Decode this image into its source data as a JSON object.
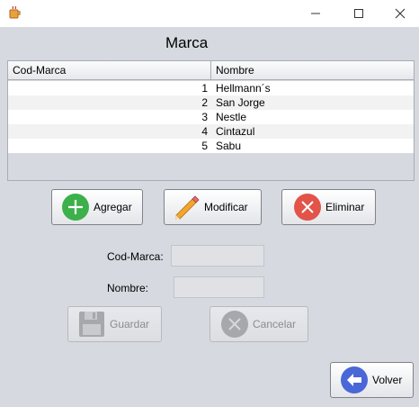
{
  "window": {
    "title": "",
    "icon": "java-cup-icon",
    "controls": [
      "minimize-icon",
      "maximize-icon",
      "close-icon"
    ]
  },
  "form": {
    "title": "Marca"
  },
  "table": {
    "columns": [
      "Cod-Marca",
      "Nombre"
    ],
    "rows": [
      {
        "cod": "1",
        "nombre": "Hellmann´s"
      },
      {
        "cod": "2",
        "nombre": "San Jorge"
      },
      {
        "cod": "3",
        "nombre": "Nestle"
      },
      {
        "cod": "4",
        "nombre": "Cintazul"
      },
      {
        "cod": "5",
        "nombre": "Sabu"
      }
    ]
  },
  "actions": {
    "agregar": {
      "label": "Agregar",
      "icon": "plus-icon",
      "color": "#3cb04a"
    },
    "modificar": {
      "label": "Modificar",
      "icon": "pencil-icon",
      "color": "#f2a72c"
    },
    "eliminar": {
      "label": "Eliminar",
      "icon": "x-circle-icon",
      "color": "#e2534a"
    }
  },
  "fields": {
    "cod_label": "Cod-Marca:",
    "cod_value": "",
    "nombre_label": "Nombre:",
    "nombre_value": ""
  },
  "edit_actions": {
    "guardar": {
      "label": "Guardar",
      "icon": "floppy-disk-icon",
      "enabled": false
    },
    "cancelar": {
      "label": "Cancelar",
      "icon": "x-circle-icon",
      "enabled": false
    }
  },
  "nav": {
    "volver": {
      "label": "Volver",
      "icon": "arrow-left-icon",
      "color": "#4a67d8"
    }
  }
}
